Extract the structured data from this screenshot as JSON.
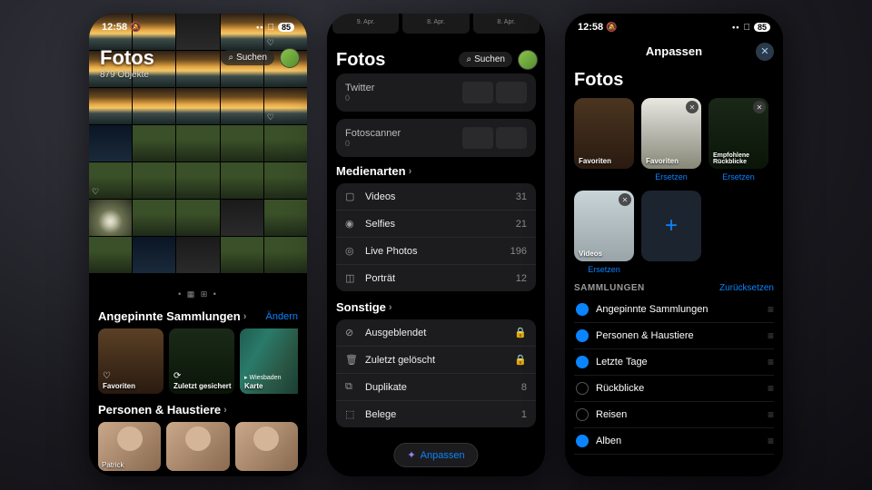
{
  "status": {
    "time": "12:58",
    "bell": "🔕",
    "battery": "85"
  },
  "p1": {
    "title": "Fotos",
    "count": "879 Objekte",
    "search": "Suchen",
    "sec_pinned": "Angepinnte Sammlungen",
    "edit": "Ändern",
    "coll": {
      "fav": "Favoriten",
      "recent": "Zuletzt gesichert",
      "map": "Karte",
      "maploc": "Wiesbaden"
    },
    "sec_people": "Personen & Haustiere",
    "person1": "Patrick"
  },
  "p2": {
    "peek1": "9. Apr.",
    "peek2": "8. Apr.",
    "peek3": "8. Apr.",
    "title": "Fotos",
    "search": "Suchen",
    "card1": {
      "name": "Twitter",
      "count": "0"
    },
    "card2": {
      "name": "Fotoscanner",
      "count": "0"
    },
    "sec_media": "Medienarten",
    "media": [
      {
        "icon": "▢",
        "name": "Videos",
        "val": "31"
      },
      {
        "icon": "◉",
        "name": "Selfies",
        "val": "21"
      },
      {
        "icon": "◎",
        "name": "Live Photos",
        "val": "196"
      },
      {
        "icon": "◫",
        "name": "Porträt",
        "val": "12"
      }
    ],
    "sec_other": "Sonstige",
    "other": [
      {
        "icon": "⊘",
        "name": "Ausgeblendet",
        "val": "",
        "lock": true
      },
      {
        "icon": "🗑",
        "name": "Zuletzt gelöscht",
        "val": "",
        "lock": true
      },
      {
        "icon": "⧉",
        "name": "Duplikate",
        "val": "8"
      },
      {
        "icon": "⬚",
        "name": "Belege",
        "val": "1"
      }
    ],
    "customize": "Anpassen"
  },
  "p3": {
    "hdr": "Anpassen",
    "title": "Fotos",
    "tiles": {
      "fav": "Favoriten",
      "mem": "Empfohlene Rückblicke",
      "vid": "Videos"
    },
    "replace": "Ersetzen",
    "samm_hdr": "SAMMLUNGEN",
    "reset": "Zurücksetzen",
    "rows": [
      {
        "on": true,
        "name": "Angepinnte Sammlungen"
      },
      {
        "on": true,
        "name": "Personen & Haustiere"
      },
      {
        "on": true,
        "name": "Letzte Tage"
      },
      {
        "on": false,
        "name": "Rückblicke"
      },
      {
        "on": false,
        "name": "Reisen"
      },
      {
        "on": true,
        "name": "Alben"
      }
    ]
  }
}
